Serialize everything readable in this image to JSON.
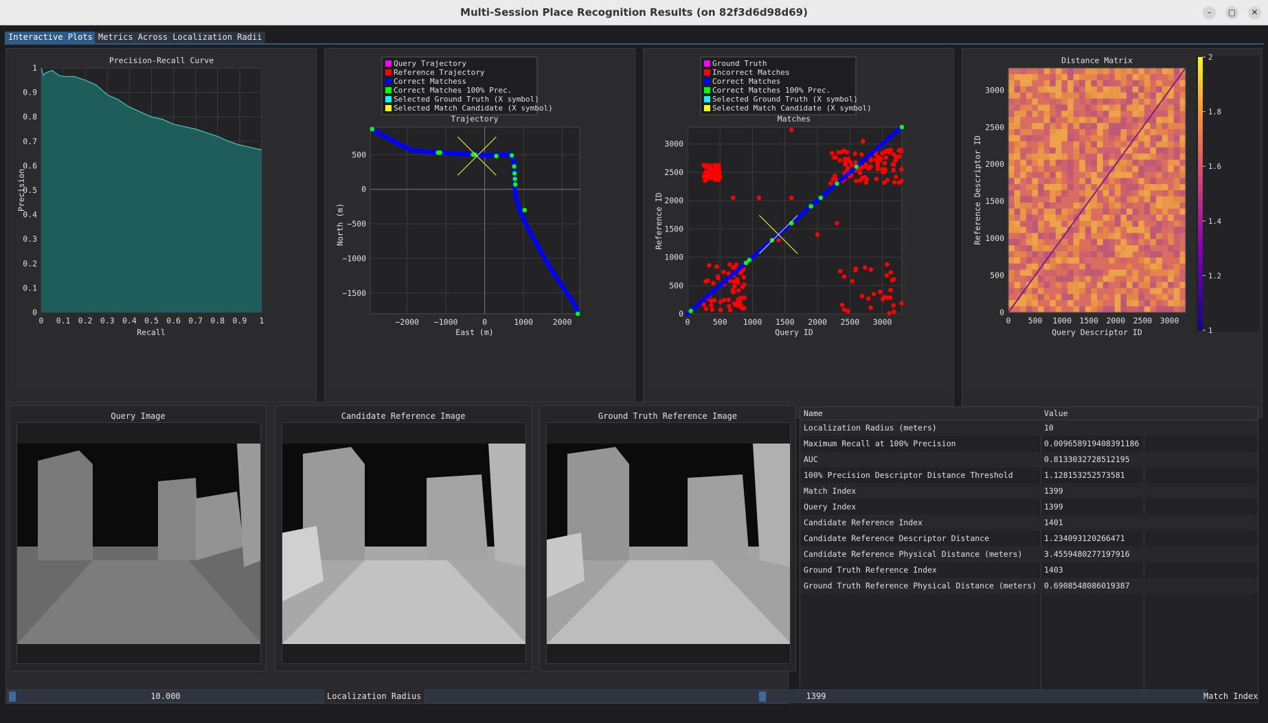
{
  "window": {
    "title": "Multi-Session Place Recognition Results (on 82f3d6d98d69)",
    "minimize_glyph": "–",
    "restore_glyph": "▢",
    "close_glyph": "✕"
  },
  "tabs": [
    {
      "label": "Interactive Plots",
      "active": true
    },
    {
      "label": "Metrics Across Localization Radii",
      "active": false
    }
  ],
  "colors": {
    "accent": "#2f5b8a",
    "pr_fill": "#1f5d5a",
    "pr_line": "#47c9c0",
    "query": "#ff00ff",
    "reference": "#ff0000",
    "correct": "#0000ff",
    "correct100": "#00ff00",
    "ground_truth_x": "#00ffff",
    "candidate_x": "#ffff00"
  },
  "pr_curve": {
    "title": "Precision-Recall Curve",
    "xlabel": "Recall",
    "ylabel": "Precision",
    "xticks": [
      "0",
      "0.1",
      "0.2",
      "0.3",
      "0.4",
      "0.5",
      "0.6",
      "0.7",
      "0.8",
      "0.9",
      "1"
    ],
    "yticks": [
      "0",
      "0.1",
      "0.2",
      "0.3",
      "0.4",
      "0.5",
      "0.6",
      "0.7",
      "0.8",
      "0.9",
      "1"
    ]
  },
  "trajectory": {
    "title": "Trajectory",
    "xlabel": "East (m)",
    "ylabel": "North (m)",
    "xticks": [
      "−2000",
      "−1000",
      "0",
      "1000",
      "2000"
    ],
    "yticks": [
      "500",
      "0",
      "−500",
      "−1000",
      "−1500"
    ],
    "legend": [
      {
        "label": "Query Trajectory",
        "color": "#ff00ff"
      },
      {
        "label": "Reference Trajectory",
        "color": "#ff0000"
      },
      {
        "label": "Correct Matchess",
        "color": "#0000ff"
      },
      {
        "label": "Correct Matches 100% Prec.",
        "color": "#00ff00"
      },
      {
        "label": "Selected Ground Truth (X symbol)",
        "color": "#00ffff"
      },
      {
        "label": "Selected Match Candidate (X symbol)",
        "color": "#ffff00"
      }
    ]
  },
  "matches": {
    "title": "Matches",
    "xlabel": "Query ID",
    "ylabel": "Reference ID",
    "xticks": [
      "0",
      "500",
      "1000",
      "1500",
      "2000",
      "2500",
      "3000"
    ],
    "yticks": [
      "0",
      "500",
      "1000",
      "1500",
      "2000",
      "2500",
      "3000"
    ],
    "legend": [
      {
        "label": "Ground Truth",
        "color": "#ff00ff"
      },
      {
        "label": "Incorrect Matches",
        "color": "#ff0000"
      },
      {
        "label": "Correct Matches",
        "color": "#0000ff"
      },
      {
        "label": "Correct Matches 100% Prec.",
        "color": "#00ff00"
      },
      {
        "label": "Selected Ground Truth (X symbol)",
        "color": "#00ffff"
      },
      {
        "label": "Selected Match Candidate (X symbol)",
        "color": "#ffff00"
      }
    ]
  },
  "distance_matrix": {
    "title": "Distance Matrix",
    "xlabel": "Query Descriptor ID",
    "ylabel": "Reference Descriptor ID",
    "xticks": [
      "0",
      "500",
      "1000",
      "1500",
      "2000",
      "2500",
      "3000"
    ],
    "yticks": [
      "0",
      "500",
      "1000",
      "1500",
      "2000",
      "2500",
      "3000"
    ],
    "colorbar_ticks": [
      "2",
      "1.8",
      "1.6",
      "1.4",
      "1.2",
      "1"
    ]
  },
  "images": {
    "query_title": "Query Image",
    "candidate_title": "Candidate Reference Image",
    "ground_truth_title": "Ground Truth Reference Image"
  },
  "table": {
    "headers": [
      "Name",
      "Value"
    ],
    "rows": [
      {
        "name": "Localization Radius (meters)",
        "value": "10"
      },
      {
        "name": "Maximum Recall at 100% Precision",
        "value": "0.009658919408391186"
      },
      {
        "name": "AUC",
        "value": "0.8133032728512195"
      },
      {
        "name": "100% Precision Descriptor Distance Threshold",
        "value": "1.128153252573581"
      },
      {
        "name": "Match Index",
        "value": "1399"
      },
      {
        "name": "Query Index",
        "value": "1399"
      },
      {
        "name": "Candidate Reference Index",
        "value": "1401"
      },
      {
        "name": "Candidate Reference Descriptor Distance",
        "value": "1.234093120266471"
      },
      {
        "name": "Candidate Reference Physical Distance (meters)",
        "value": "3.4559480277197916"
      },
      {
        "name": "Ground Truth Reference Index",
        "value": "1403"
      },
      {
        "name": "Ground Truth Reference Physical Distance (meters)",
        "value": "0.6908548086019387"
      }
    ]
  },
  "controls": {
    "radius_value": "10.000",
    "radius_label": "Localization Radius",
    "radius_fraction": 0.0,
    "match_value": "1399",
    "match_label": "Match Index",
    "match_fraction": 0.43
  },
  "chart_data": [
    {
      "type": "area",
      "title": "Precision-Recall Curve",
      "xlabel": "Recall",
      "ylabel": "Precision",
      "xlim": [
        0,
        1
      ],
      "ylim": [
        0,
        1
      ],
      "x": [
        0,
        0.01,
        0.02,
        0.05,
        0.08,
        0.1,
        0.15,
        0.2,
        0.25,
        0.3,
        0.35,
        0.4,
        0.45,
        0.5,
        0.55,
        0.6,
        0.65,
        0.7,
        0.75,
        0.8,
        0.85,
        0.9,
        0.95,
        1.0
      ],
      "y": [
        1.0,
        0.97,
        0.98,
        0.99,
        0.97,
        0.965,
        0.965,
        0.95,
        0.93,
        0.89,
        0.87,
        0.84,
        0.82,
        0.8,
        0.79,
        0.77,
        0.76,
        0.75,
        0.735,
        0.72,
        0.7,
        0.685,
        0.675,
        0.665
      ]
    },
    {
      "type": "scatter",
      "title": "Trajectory",
      "xlabel": "East (m)",
      "ylabel": "North (m)",
      "xlim": [
        -2950,
        2450
      ],
      "ylim": [
        -1800,
        900
      ],
      "series": [
        {
          "name": "Correct Matchess",
          "x": [
            -2900,
            -2700,
            -2300,
            -1900,
            -1500,
            -1100,
            -800,
            -500,
            -200,
            200,
            500,
            700,
            750,
            780,
            780,
            800,
            900,
            1100,
            1400,
            1700,
            2000,
            2300,
            2400
          ],
          "y": [
            870,
            800,
            680,
            570,
            540,
            530,
            520,
            510,
            500,
            490,
            500,
            500,
            400,
            200,
            0,
            -100,
            -300,
            -550,
            -850,
            -1150,
            -1400,
            -1650,
            -1800
          ]
        },
        {
          "name": "Correct Matches 100% Prec.",
          "x": [
            -2900,
            -1200,
            -1150,
            -300,
            -250,
            300,
            700,
            760,
            770,
            780,
            790,
            1030,
            2400
          ],
          "y": [
            870,
            530,
            530,
            500,
            500,
            480,
            490,
            330,
            230,
            150,
            70,
            -300,
            -1800
          ]
        }
      ],
      "markers": [
        {
          "name": "Selected Match Candidate (X symbol)",
          "x": -200,
          "y": 480
        }
      ]
    },
    {
      "type": "scatter",
      "title": "Matches",
      "xlabel": "Query ID",
      "ylabel": "Reference ID",
      "xlim": [
        0,
        3300
      ],
      "ylim": [
        0,
        3300
      ],
      "series": [
        {
          "name": "Correct Matches",
          "x": [
            0,
            500,
            1000,
            1500,
            2000,
            2500,
            3000,
            3300
          ],
          "y": [
            0,
            500,
            1000,
            1500,
            2000,
            2500,
            3000,
            3300
          ]
        },
        {
          "name": "Correct Matches 100% Prec.",
          "x": [
            50,
            900,
            950,
            1300,
            1600,
            1900,
            2050,
            2300,
            2600,
            3300
          ],
          "y": [
            50,
            900,
            950,
            1300,
            1600,
            1900,
            2050,
            2300,
            2600,
            3300
          ]
        }
      ],
      "markers": [
        {
          "name": "Selected Match Candidate (X symbol)",
          "x": 1399,
          "y": 1401
        }
      ]
    },
    {
      "type": "heatmap",
      "title": "Distance Matrix",
      "xlabel": "Query Descriptor ID",
      "ylabel": "Reference Descriptor ID",
      "xlim": [
        0,
        3300
      ],
      "ylim": [
        0,
        3300
      ],
      "colorbar_range": [
        1,
        2
      ]
    }
  ]
}
